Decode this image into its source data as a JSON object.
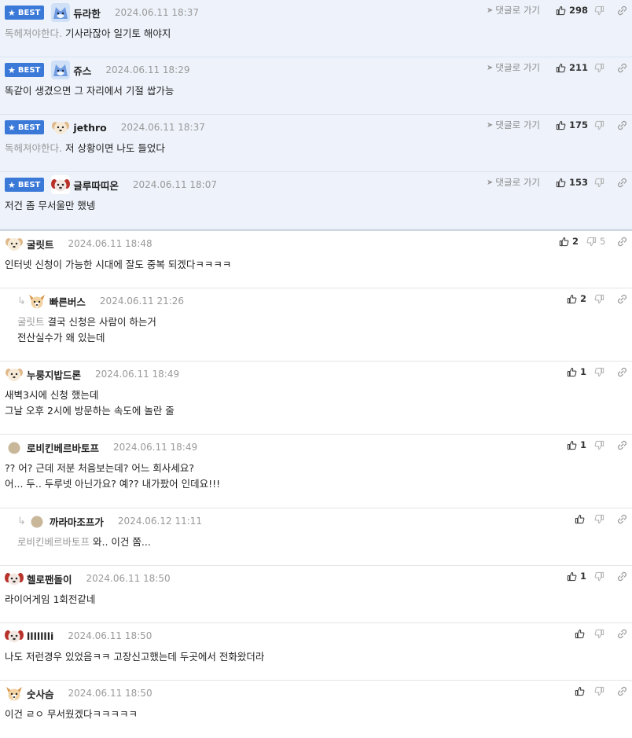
{
  "comments": [
    {
      "type": "best",
      "badge": "BEST",
      "nick": "듀라한",
      "date": "2024.06.11 18:37",
      "quote": "독헤져야한다.",
      "text": [
        "기사라잖아 일기토 해야지"
      ],
      "goto": "댓글로 가기",
      "up": "298",
      "down": "",
      "avatar": "blue-fox"
    },
    {
      "type": "best",
      "badge": "BEST",
      "nick": "쥬스",
      "date": "2024.06.11 18:29",
      "quote": "",
      "text": [
        "똑같이 생겼으면 그 자리에서 기절 쌉가능"
      ],
      "goto": "댓글로 가기",
      "up": "211",
      "down": "",
      "avatar": "blue-fox"
    },
    {
      "type": "best",
      "badge": "BEST",
      "nick": "jethro",
      "date": "2024.06.11 18:37",
      "quote": "독헤져야한다.",
      "text": [
        "저 상황이면 나도 들었다"
      ],
      "goto": "댓글로 가기",
      "up": "175",
      "down": "",
      "avatar": "dog"
    },
    {
      "type": "best",
      "badge": "BEST",
      "nick": "글루따띠온",
      "date": "2024.06.11 18:07",
      "quote": "",
      "text": [
        "저건 좀 무서울만 했넹"
      ],
      "goto": "댓글로 가기",
      "up": "153",
      "down": "",
      "avatar": "red-dog"
    },
    {
      "type": "normal",
      "nick": "굴릿트",
      "date": "2024.06.11 18:48",
      "quote": "",
      "text": [
        "인터넷 신청이 가능한 시대에 잘도 중복 되겠다ㅋㅋㅋㅋ"
      ],
      "up": "2",
      "down": "5",
      "avatar": "dog"
    },
    {
      "type": "reply",
      "nick": "빠른버스",
      "date": "2024.06.11 21:26",
      "quote": "굴릿트",
      "text": [
        "결국 신청은 사람이 하는거",
        "전산실수가 왜 있는데"
      ],
      "up": "2",
      "down": "",
      "avatar": "chihuahua"
    },
    {
      "type": "normal",
      "nick": "누룽지밥드론",
      "date": "2024.06.11 18:49",
      "quote": "",
      "text": [
        "새벽3시에 신청 했는데",
        "그날 오후 2시에 방문하는 속도에 놀란 줄"
      ],
      "up": "1",
      "down": "",
      "avatar": "dog"
    },
    {
      "type": "normal",
      "nick": "로비킨베르바토프",
      "date": "2024.06.11 18:49",
      "quote": "",
      "text": [
        "?? 어? 근데 저분 처음보는데? 어느 회사세요?",
        "어... 두.. 두루넷 아닌가요? 예?? 내가팠어 인데요!!!"
      ],
      "up": "1",
      "down": "",
      "avatar": "dot"
    },
    {
      "type": "reply",
      "nick": "까라마조프가",
      "date": "2024.06.12 11:11",
      "quote": "로비킨베르바토프",
      "text": [
        "와.. 이건 쫌..."
      ],
      "up": "",
      "down": "",
      "avatar": "dot"
    },
    {
      "type": "normal",
      "nick": "헬로팬돌이",
      "date": "2024.06.11 18:50",
      "quote": "",
      "text": [
        "라이어게임 1회전같네"
      ],
      "up": "1",
      "down": "",
      "avatar": "red-dog"
    },
    {
      "type": "normal",
      "nick": "llllllli",
      "date": "2024.06.11 18:50",
      "quote": "",
      "text": [
        "나도 저런경우 있었음ㅋㅋ 고장신고했는데 두곳에서 전화왔더라"
      ],
      "up": "",
      "down": "",
      "avatar": "red-dog"
    },
    {
      "type": "normal",
      "nick": "숫사슴",
      "date": "2024.06.11 18:50",
      "quote": "",
      "text": [
        "이건 ㄹㅇ 무서웠겠다ㅋㅋㅋㅋㅋ"
      ],
      "up": "",
      "down": "",
      "avatar": "chihuahua"
    }
  ],
  "colors": {
    "best_bg": "#eef3fb",
    "badge": "#3b79d8",
    "meta": "#999999"
  }
}
